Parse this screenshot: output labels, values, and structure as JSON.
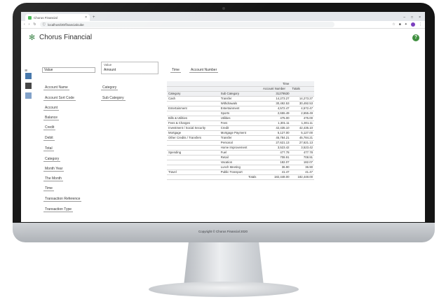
{
  "browser": {
    "tab_title": "Chorus Financial",
    "new_tab_symbol": "+",
    "close_symbol": "×",
    "window_controls": [
      "–",
      "□",
      "×"
    ],
    "url": "localhost/30/financialcube"
  },
  "app": {
    "brand": "Chorus Financial",
    "help_symbol": "?",
    "accent": "#3f8f3f"
  },
  "fields": {
    "search_value": "Value",
    "account_name": "Account Name",
    "account_sort_code": "Account Sort Code",
    "account": "Account",
    "balance": "Balance",
    "credit": "Credit",
    "debit": "Debit",
    "total": "Total",
    "category_group": "Category",
    "category": "Category",
    "sub_category": "Sub Category",
    "month_year": "Month Year",
    "the_month_year": "The Month",
    "time": "Time",
    "transaction_reference": "Transaction Reference",
    "transaction_type": "Transaction Type"
  },
  "selector": {
    "label": "Value",
    "value": "Amount"
  },
  "pivot_chips": [
    "Time",
    "Account Number"
  ],
  "table": {
    "header_top": "Time",
    "header_sub": "Account Number",
    "header_col": "31279530",
    "total_header": "Totals",
    "row_header_a": "Category",
    "row_header_b": "Sub Category",
    "rows": [
      {
        "cat": "Cash",
        "sub": "Transfer",
        "v": "14,273.27",
        "t": "14,273.27"
      },
      {
        "cat": "",
        "sub": "Withdrawals",
        "v": "30,492.53",
        "t": "30,492.53"
      },
      {
        "cat": "Entertainment",
        "sub": "Entertainment",
        "v": "4,572.47",
        "t": "4,572.47"
      },
      {
        "cat": "",
        "sub": "Sports",
        "v": "2,655.49",
        "t": "2,655.49"
      },
      {
        "cat": "Bills & Utilities",
        "sub": "Utilities",
        "v": "475.00",
        "t": "475.00"
      },
      {
        "cat": "Fees & Charges",
        "sub": "Fees",
        "v": "1,301.11",
        "t": "1,301.11"
      },
      {
        "cat": "Investment / Social Security",
        "sub": "Credit",
        "v": "42,435.10",
        "t": "42,435.10"
      },
      {
        "cat": "Mortgage",
        "sub": "Mortgage Payment",
        "v": "5,127.00",
        "t": "5,127.00"
      },
      {
        "cat": "Other Credits / Transfers",
        "sub": "Transfer",
        "v": "45,784.21",
        "t": "45,784.21"
      },
      {
        "cat": "",
        "sub": "Personal",
        "v": "27,621.13",
        "t": "27,621.13"
      },
      {
        "cat": "",
        "sub": "Home Improvement",
        "v": "3,523.42",
        "t": "3,523.42"
      },
      {
        "cat": "Spending",
        "sub": "Fuel",
        "v": "477.78",
        "t": "477.78"
      },
      {
        "cat": "",
        "sub": "Retail",
        "v": "708.91",
        "t": "708.91"
      },
      {
        "cat": "",
        "sub": "Vacation",
        "v": "182.07",
        "t": "182.07"
      },
      {
        "cat": "",
        "sub": "Lunch Meeting",
        "v": "36.90",
        "t": "36.90"
      },
      {
        "cat": "Travel",
        "sub": "Public Transport",
        "v": "41.47",
        "t": "41.47"
      }
    ],
    "totals_label": "Totals",
    "totals_value": "182,448.00",
    "totals_total": "182,448.00"
  },
  "footer": "Copyright © Chorus Financial 2020"
}
